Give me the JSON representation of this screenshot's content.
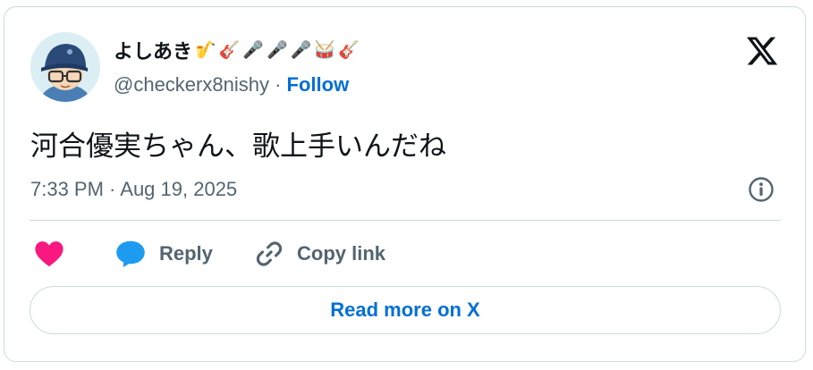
{
  "author": {
    "display_name": "よしあき",
    "name_emojis": [
      "🎷",
      "🎸",
      "🎤",
      "🎤",
      "🎤",
      "🥁",
      "🎸"
    ],
    "handle": "@checkerx8nishy",
    "separator": "·",
    "follow_label": "Follow",
    "avatar_icon": "avatar-cap-glasses-icon"
  },
  "post": {
    "text": "河合優実ちゃん、歌上手いんだね",
    "timestamp": "7:33 PM · Aug 19, 2025"
  },
  "actions": {
    "like_icon": "heart-icon",
    "reply_label": "Reply",
    "copy_link_label": "Copy link"
  },
  "footer": {
    "read_more_label": "Read more on X"
  },
  "colors": {
    "accent": "#006fd6",
    "like": "#f91880",
    "reply_bubble": "#1d9bf0",
    "secondary_text": "#536471",
    "border": "#cfd9de"
  }
}
